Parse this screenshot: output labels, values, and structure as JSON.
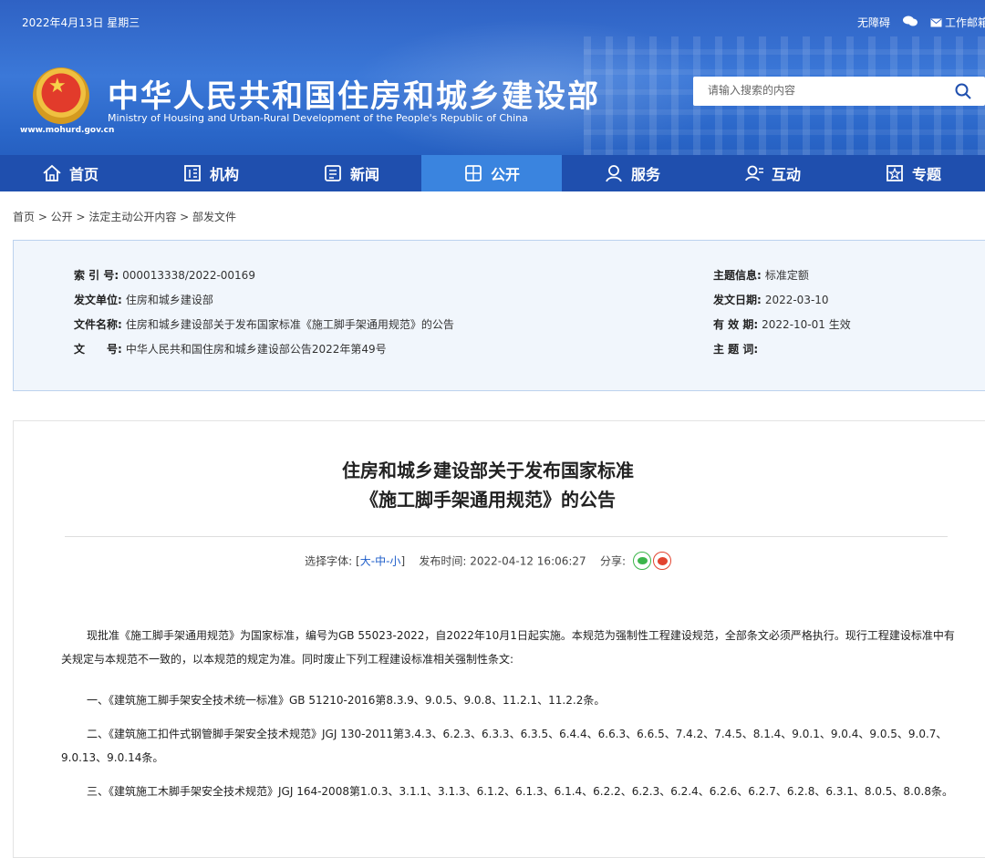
{
  "topbar": {
    "date": "2022年4月13日 星期三",
    "accessibility": "无障碍",
    "wechat_icon": "wechat-icon",
    "mail": "工作邮箱"
  },
  "site": {
    "url": "www.mohurd.gov.cn",
    "title": "中华人民共和国住房和城乡建设部",
    "subtitle": "Ministry of Housing and Urban-Rural Development of the People's Republic of China"
  },
  "search": {
    "placeholder": "请输入搜索的内容"
  },
  "nav": {
    "items": [
      {
        "label": "首页",
        "icon": "home-icon"
      },
      {
        "label": "机构",
        "icon": "org-icon"
      },
      {
        "label": "新闻",
        "icon": "news-icon"
      },
      {
        "label": "公开",
        "icon": "public-icon",
        "active": true
      },
      {
        "label": "服务",
        "icon": "service-icon"
      },
      {
        "label": "互动",
        "icon": "interact-icon"
      },
      {
        "label": "专题",
        "icon": "topic-icon"
      }
    ]
  },
  "breadcrumb": "首页 > 公开 > 法定主动公开内容 > 部发文件",
  "meta": {
    "index_label": "索 引 号:",
    "index_value": "000013338/2022-00169",
    "issuer_label": "发文单位:",
    "issuer_value": "住房和城乡建设部",
    "filename_label": "文件名称:",
    "filename_value": "住房和城乡建设部关于发布国家标准《施工脚手架通用规范》的公告",
    "docno_label": "文　　号:",
    "docno_value": "中华人民共和国住房和城乡建设部公告2022年第49号",
    "subject_label": "主题信息:",
    "subject_value": "标准定额",
    "date_label": "发文日期:",
    "date_value": "2022-03-10",
    "valid_label": "有 效 期:",
    "valid_value": "2022-10-01 生效",
    "keywords_label": "主 题 词:",
    "keywords_value": ""
  },
  "article": {
    "title_line1": "住房和城乡建设部关于发布国家标准",
    "title_line2": "《施工脚手架通用规范》的公告",
    "font_label": "选择字体: [",
    "font_large": "大",
    "font_medium": "中",
    "font_small": "小",
    "font_end": "]",
    "publish_label": "发布时间: 2022-04-12 16:06:27",
    "share_label": "分享:",
    "paragraphs": [
      "现批准《施工脚手架通用规范》为国家标准，编号为GB 55023-2022，自2022年10月1日起实施。本规范为强制性工程建设规范，全部条文必须严格执行。现行工程建设标准中有关规定与本规范不一致的，以本规范的规定为准。同时废止下列工程建设标准相关强制性条文:",
      "一、《建筑施工脚手架安全技术统一标准》GB 51210-2016第8.3.9、9.0.5、9.0.8、11.2.1、11.2.2条。",
      "二、《建筑施工扣件式钢管脚手架安全技术规范》JGJ 130-2011第3.4.3、6.2.3、6.3.3、6.3.5、6.4.4、6.6.3、6.6.5、7.4.2、7.4.5、8.1.4、9.0.1、9.0.4、9.0.5、9.0.7、9.0.13、9.0.14条。",
      "三、《建筑施工木脚手架安全技术规范》JGJ 164-2008第1.0.3、3.1.1、3.1.3、6.1.2、6.1.3、6.1.4、6.2.2、6.2.3、6.2.4、6.2.6、6.2.7、6.2.8、6.3.1、8.0.5、8.0.8条。"
    ]
  }
}
